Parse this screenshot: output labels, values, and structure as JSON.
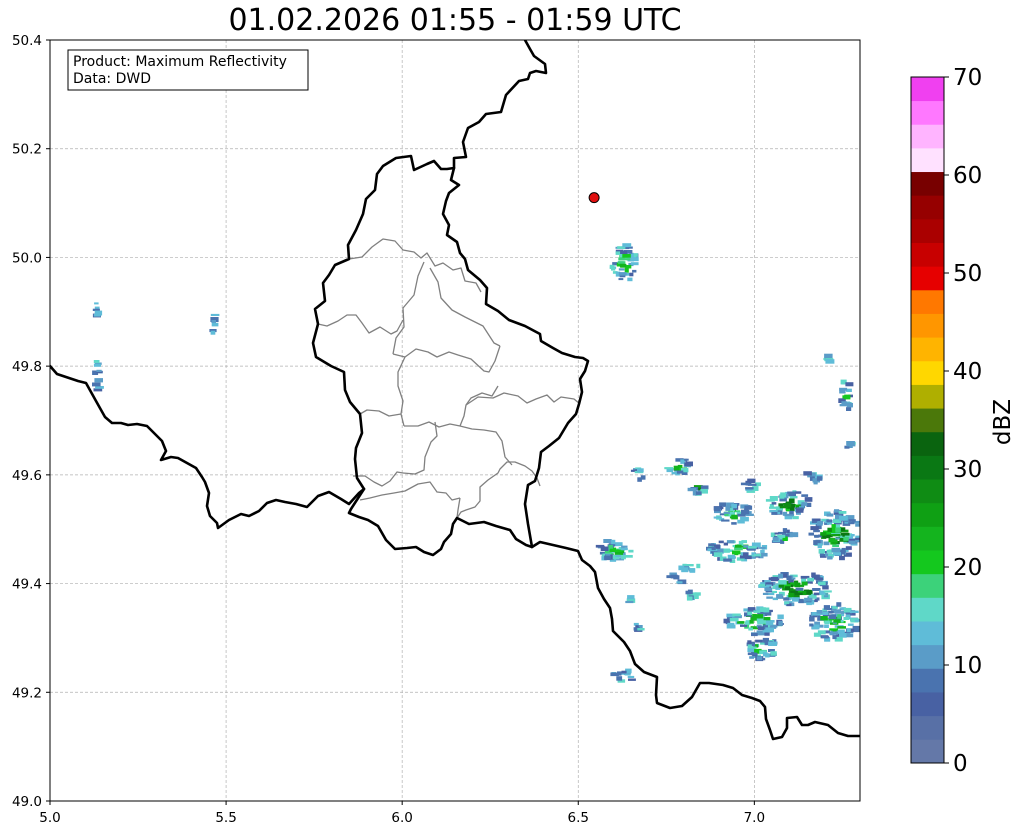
{
  "title": "01.02.2026 01:55 - 01:59 UTC",
  "info": {
    "product": "Product: Maximum Reflectivity",
    "data": "Data: DWD"
  },
  "map": {
    "lon_range": [
      5.0,
      7.3
    ],
    "lat_range": [
      49.0,
      50.4
    ],
    "x_ticks": [
      "5.0",
      "5.5",
      "6.0",
      "6.5",
      "7.0"
    ],
    "x_tick_values": [
      5.0,
      5.5,
      6.0,
      6.5,
      7.0
    ],
    "y_ticks": [
      "49.0",
      "49.2",
      "49.4",
      "49.6",
      "49.8",
      "50.0",
      "50.2",
      "50.4"
    ],
    "y_tick_values": [
      49.0,
      49.2,
      49.4,
      49.6,
      49.8,
      50.0,
      50.2,
      50.4
    ],
    "grid": true,
    "marker": {
      "lon": 6.545,
      "lat": 50.11,
      "color": "#e01010"
    },
    "border_color": "#000000",
    "district_color": "#808080"
  },
  "colorbar": {
    "label": "dBZ",
    "ticks": [
      "0",
      "10",
      "20",
      "30",
      "40",
      "50",
      "60",
      "70"
    ],
    "tick_values": [
      0,
      10,
      20,
      30,
      40,
      50,
      60,
      70
    ],
    "range": [
      0,
      70
    ],
    "colors": [
      "#6478a8",
      "#5870a6",
      "#4861a3",
      "#4a73af",
      "#5a9cc8",
      "#5fbcd8",
      "#5fd8c8",
      "#3cd27a",
      "#14c81e",
      "#14b41e",
      "#0fa014",
      "#0f8c14",
      "#0a7814",
      "#0a640f",
      "#4b780a",
      "#afaf00",
      "#ffd700",
      "#ffb400",
      "#ff9600",
      "#ff7800",
      "#e60000",
      "#c80000",
      "#aa0000",
      "#960000",
      "#780000",
      "#ffe1ff",
      "#ffb4ff",
      "#ff78ff",
      "#f040f0"
    ]
  },
  "radar_cells": [
    {
      "lon": 6.63,
      "lat": 49.99,
      "w": 0.07,
      "h": 0.07,
      "level": "light",
      "core": "moderate"
    },
    {
      "lon": 5.135,
      "lat": 49.78,
      "w": 0.02,
      "h": 0.06,
      "level": "light"
    },
    {
      "lon": 5.135,
      "lat": 49.905,
      "w": 0.01,
      "h": 0.05,
      "level": "light"
    },
    {
      "lon": 5.465,
      "lat": 49.88,
      "w": 0.015,
      "h": 0.04,
      "level": "light"
    },
    {
      "lon": 6.6,
      "lat": 49.46,
      "w": 0.1,
      "h": 0.04,
      "level": "light",
      "core": "moderate"
    },
    {
      "lon": 6.67,
      "lat": 49.6,
      "w": 0.04,
      "h": 0.02,
      "level": "light",
      "core": "moderate"
    },
    {
      "lon": 6.79,
      "lat": 49.615,
      "w": 0.07,
      "h": 0.03,
      "level": "light",
      "core": "moderate"
    },
    {
      "lon": 6.84,
      "lat": 49.575,
      "w": 0.04,
      "h": 0.03,
      "level": "light",
      "core": "strong"
    },
    {
      "lon": 6.94,
      "lat": 49.53,
      "w": 0.1,
      "h": 0.04,
      "level": "light",
      "core": "moderate"
    },
    {
      "lon": 7.1,
      "lat": 49.545,
      "w": 0.12,
      "h": 0.05,
      "level": "light",
      "core": "strong"
    },
    {
      "lon": 7.23,
      "lat": 49.49,
      "w": 0.14,
      "h": 0.09,
      "level": "light",
      "core": "strong"
    },
    {
      "lon": 6.95,
      "lat": 49.46,
      "w": 0.17,
      "h": 0.04,
      "level": "light",
      "core": "moderate"
    },
    {
      "lon": 7.08,
      "lat": 49.485,
      "w": 0.07,
      "h": 0.03,
      "level": "light",
      "core": "moderate"
    },
    {
      "lon": 7.12,
      "lat": 49.39,
      "w": 0.2,
      "h": 0.06,
      "level": "light",
      "core": "strong"
    },
    {
      "lon": 7.0,
      "lat": 49.33,
      "w": 0.16,
      "h": 0.05,
      "level": "light",
      "core": "moderate"
    },
    {
      "lon": 7.23,
      "lat": 49.33,
      "w": 0.14,
      "h": 0.07,
      "level": "light",
      "core": "moderate"
    },
    {
      "lon": 7.02,
      "lat": 49.28,
      "w": 0.1,
      "h": 0.04,
      "level": "light",
      "core": "moderate"
    },
    {
      "lon": 6.83,
      "lat": 49.38,
      "w": 0.05,
      "h": 0.02,
      "level": "light"
    },
    {
      "lon": 6.65,
      "lat": 49.37,
      "w": 0.015,
      "h": 0.015,
      "level": "light"
    },
    {
      "lon": 6.67,
      "lat": 49.32,
      "w": 0.02,
      "h": 0.015,
      "level": "light"
    },
    {
      "lon": 6.78,
      "lat": 49.41,
      "w": 0.04,
      "h": 0.02,
      "level": "light"
    },
    {
      "lon": 6.82,
      "lat": 49.43,
      "w": 0.06,
      "h": 0.015,
      "level": "light"
    },
    {
      "lon": 6.63,
      "lat": 49.23,
      "w": 0.07,
      "h": 0.02,
      "level": "light"
    },
    {
      "lon": 7.26,
      "lat": 49.745,
      "w": 0.03,
      "h": 0.06,
      "level": "light",
      "core": "moderate"
    },
    {
      "lon": 7.21,
      "lat": 49.81,
      "w": 0.01,
      "h": 0.02,
      "level": "light"
    },
    {
      "lon": 7.27,
      "lat": 49.655,
      "w": 0.02,
      "h": 0.015,
      "level": "light"
    },
    {
      "lon": 7.17,
      "lat": 49.6,
      "w": 0.04,
      "h": 0.03,
      "level": "light"
    },
    {
      "lon": 6.99,
      "lat": 49.58,
      "w": 0.06,
      "h": 0.02,
      "level": "light"
    }
  ]
}
